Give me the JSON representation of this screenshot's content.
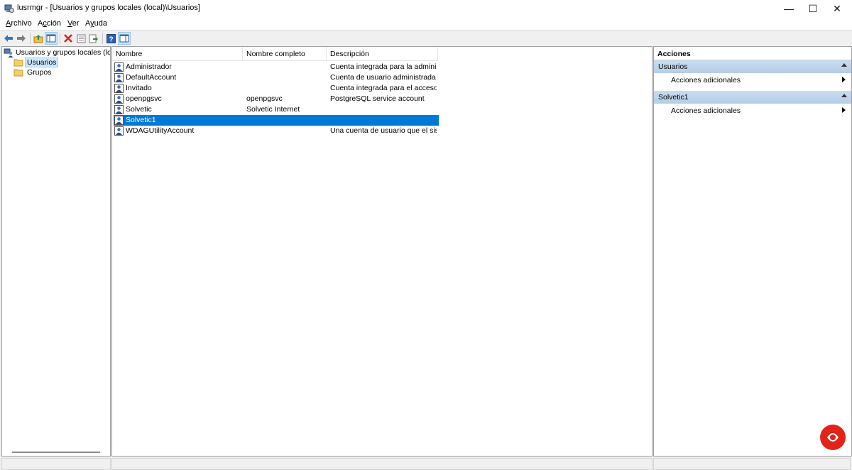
{
  "window": {
    "title": "lusrmgr - [Usuarios y grupos locales (local)\\Usuarios]",
    "minimize": "—",
    "maximize": "☐",
    "close": "✕"
  },
  "menu": {
    "archivo": {
      "first": "A",
      "rest": "rchivo"
    },
    "accion": {
      "first": "A",
      "mid": "c",
      "rest": "ción"
    },
    "ver": {
      "first": "V",
      "rest": "er"
    },
    "ayuda": {
      "first": "A",
      "mid": "y",
      "rest": "uda"
    }
  },
  "toolbar": {
    "icons": [
      "back-arrow-icon",
      "forward-arrow-icon",
      "up-folder-icon",
      "show-hide-tree-icon",
      "delete-icon",
      "properties-icon",
      "export-icon",
      "help-icon",
      "show-hide-action-pane-icon"
    ]
  },
  "tree": {
    "root": "Usuarios y grupos locales (local)",
    "children": [
      "Usuarios",
      "Grupos"
    ],
    "selected": "Usuarios"
  },
  "list": {
    "columns": [
      "Nombre",
      "Nombre completo",
      "Descripción"
    ],
    "rows": [
      {
        "name": "Administrador",
        "full_name": "",
        "description": "Cuenta integrada para la administ..."
      },
      {
        "name": "DefaultAccount",
        "full_name": "",
        "description": "Cuenta de usuario administrada p..."
      },
      {
        "name": "Invitado",
        "full_name": "",
        "description": "Cuenta integrada para el acceso c..."
      },
      {
        "name": "openpgsvc",
        "full_name": "openpgsvc",
        "description": "PostgreSQL service account"
      },
      {
        "name": "Solvetic",
        "full_name": "Solvetic Internet",
        "description": ""
      },
      {
        "name": "Solvetic1",
        "full_name": "",
        "description": ""
      },
      {
        "name": "WDAGUtilityAccount",
        "full_name": "",
        "description": "Una cuenta de usuario que el siste..."
      }
    ],
    "selected": "Solvetic1"
  },
  "actions": {
    "title": "Acciones",
    "sections": [
      {
        "label": "Usuarios",
        "item": "Acciones adicionales"
      },
      {
        "label": "Solvetic1",
        "item": "Acciones adicionales"
      }
    ]
  },
  "colors": {
    "selection": "#0078d7",
    "section_header": "#c9dcf0",
    "logo_red": "#e2231a"
  }
}
